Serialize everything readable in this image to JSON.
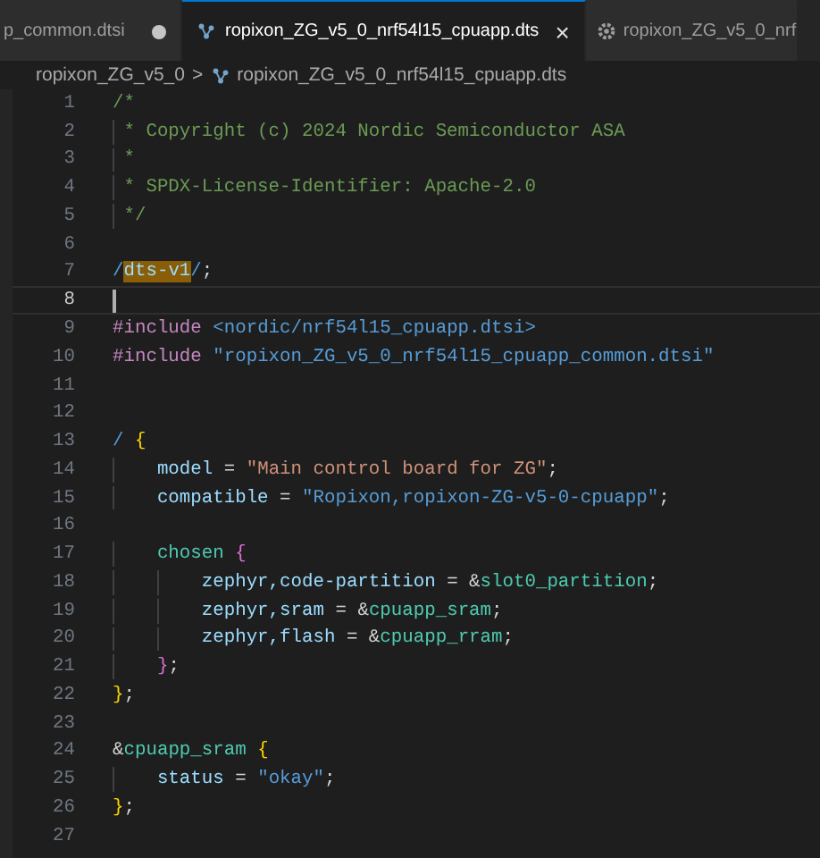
{
  "tabs": [
    {
      "label": "p_common.dtsi",
      "selected": false,
      "modified": true
    },
    {
      "label": "ropixon_ZG_v5_0_nrf54l15_cpuapp.dts",
      "selected": true,
      "modified": false,
      "close": "×"
    },
    {
      "label": "ropixon_ZG_v5_0_nrf",
      "selected": false,
      "modified": false
    }
  ],
  "breadcrumb": {
    "folder": "ropixon_ZG_v5_0",
    "separator": ">",
    "file": "ropixon_ZG_v5_0_nrf54l15_cpuapp.dts"
  },
  "editor": {
    "lines": [
      {
        "number": "1",
        "current": false,
        "tokens": [
          {
            "kind": "comment",
            "text": "/*"
          }
        ]
      },
      {
        "number": "2",
        "current": false,
        "tokens": [
          {
            "kind": "comment",
            "text": " * Copyright (c) 2024 Nordic Semiconductor ASA"
          }
        ]
      },
      {
        "number": "3",
        "current": false,
        "tokens": [
          {
            "kind": "comment",
            "text": " *"
          }
        ]
      },
      {
        "number": "4",
        "current": false,
        "tokens": [
          {
            "kind": "comment",
            "text": " * SPDX-License-Identifier: Apache-2.0"
          }
        ]
      },
      {
        "number": "5",
        "current": false,
        "tokens": [
          {
            "kind": "comment",
            "text": " */"
          }
        ]
      },
      {
        "number": "6",
        "current": false
      },
      {
        "number": "7",
        "current": false,
        "tokens": [
          {
            "kind": "operator",
            "text": "/"
          },
          {
            "kind": "selection",
            "text": "dts-v1"
          },
          {
            "kind": "operator",
            "text": "/"
          },
          {
            "kind": "punct",
            "text": ";"
          }
        ]
      },
      {
        "number": "8",
        "current": true
      },
      {
        "number": "9",
        "current": false,
        "tokens": [
          {
            "kind": "keyword",
            "text": "#include"
          },
          {
            "kind": "path",
            "text": " <nordic/nrf54l15_cpuapp.dtsi>"
          }
        ]
      },
      {
        "number": "10",
        "current": false,
        "tokens": [
          {
            "kind": "keyword",
            "text": "#include"
          },
          {
            "kind": "path",
            "text": " \"ropixon_ZG_v5_0_nrf54l15_cpuapp_common.dtsi\""
          }
        ]
      },
      {
        "number": "11",
        "current": false
      },
      {
        "number": "12",
        "current": false
      },
      {
        "number": "13",
        "current": false,
        "tokens": [
          {
            "kind": "operator",
            "text": "/"
          },
          {
            "kind": "bracket1",
            "text": " {"
          }
        ]
      },
      {
        "number": "14",
        "current": false,
        "tokens": [
          {
            "kind": "property",
            "text": "    model"
          },
          {
            "kind": "punct",
            "text": " = "
          },
          {
            "kind": "string",
            "text": "\"Main control board for ZG\""
          },
          {
            "kind": "punct",
            "text": ";"
          }
        ]
      },
      {
        "number": "15",
        "current": false,
        "tokens": [
          {
            "kind": "property",
            "text": "    compatible"
          },
          {
            "kind": "punct",
            "text": " = "
          },
          {
            "kind": "path",
            "text": "\"Ropixon,ropixon-ZG-v5-0-cpuapp\""
          },
          {
            "kind": "punct",
            "text": ";"
          }
        ]
      },
      {
        "number": "16",
        "current": false
      },
      {
        "number": "17",
        "current": false,
        "tokens": [
          {
            "kind": "label",
            "text": "    chosen"
          },
          {
            "kind": "bracket2",
            "text": " {"
          }
        ]
      },
      {
        "number": "18",
        "current": false,
        "tokens": [
          {
            "kind": "property",
            "text": "        zephyr,code-partition"
          },
          {
            "kind": "punct",
            "text": " = &"
          },
          {
            "kind": "label",
            "text": "slot0_partition"
          },
          {
            "kind": "punct",
            "text": ";"
          }
        ]
      },
      {
        "number": "19",
        "current": false,
        "tokens": [
          {
            "kind": "property",
            "text": "        zephyr,sram"
          },
          {
            "kind": "punct",
            "text": " = &"
          },
          {
            "kind": "label",
            "text": "cpuapp_sram"
          },
          {
            "kind": "punct",
            "text": ";"
          }
        ]
      },
      {
        "number": "20",
        "current": false,
        "tokens": [
          {
            "kind": "property",
            "text": "        zephyr,flash"
          },
          {
            "kind": "punct",
            "text": " = &"
          },
          {
            "kind": "label",
            "text": "cpuapp_rram"
          },
          {
            "kind": "punct",
            "text": ";"
          }
        ]
      },
      {
        "number": "21",
        "current": false,
        "tokens": [
          {
            "kind": "bracket2",
            "text": "    }"
          },
          {
            "kind": "punct",
            "text": ";"
          }
        ]
      },
      {
        "number": "22",
        "current": false,
        "tokens": [
          {
            "kind": "bracket1",
            "text": "}"
          },
          {
            "kind": "punct",
            "text": ";"
          }
        ]
      },
      {
        "number": "23",
        "current": false
      },
      {
        "number": "24",
        "current": false,
        "tokens": [
          {
            "kind": "punct",
            "text": "&"
          },
          {
            "kind": "label",
            "text": "cpuapp_sram"
          },
          {
            "kind": "bracket1",
            "text": " {"
          }
        ]
      },
      {
        "number": "25",
        "current": false,
        "tokens": [
          {
            "kind": "property",
            "text": "    status"
          },
          {
            "kind": "punct",
            "text": " = "
          },
          {
            "kind": "path",
            "text": "\"okay\""
          },
          {
            "kind": "punct",
            "text": ";"
          }
        ]
      },
      {
        "number": "26",
        "current": false,
        "tokens": [
          {
            "kind": "bracket1",
            "text": "}"
          },
          {
            "kind": "punct",
            "text": ";"
          }
        ]
      },
      {
        "number": "27",
        "current": false
      }
    ]
  }
}
